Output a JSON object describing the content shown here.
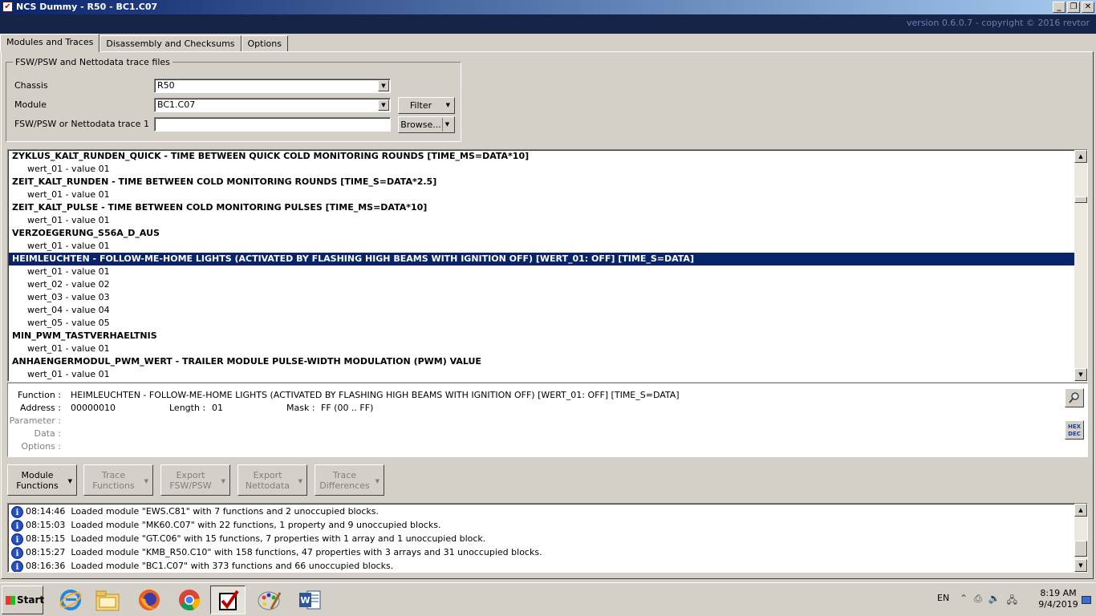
{
  "window": {
    "title": "NCS Dummy - R50 - BC1.C07",
    "minimize": "_",
    "restore": "❐",
    "close": "✕"
  },
  "banner": {
    "version": "version 0.6.0.7 - copyright © 2016 revtor"
  },
  "tabs": [
    {
      "label": "Modules and Traces"
    },
    {
      "label": "Disassembly and Checksums"
    },
    {
      "label": "Options"
    }
  ],
  "files": {
    "legend": "FSW/PSW and Nettodata trace files",
    "chassis_label": "Chassis",
    "chassis_value": "R50",
    "module_label": "Module",
    "module_value": "BC1.C07",
    "trace_label": "FSW/PSW or Nettodata trace 1",
    "trace_value": "",
    "filter_label": "Filter",
    "browse_label": "Browse..."
  },
  "functions": [
    {
      "type": "func",
      "text": "ZYKLUS_KALT_RUNDEN_QUICK  -  TIME BETWEEN QUICK COLD MONITORING ROUNDS [TIME_MS=DATA*10]"
    },
    {
      "type": "val",
      "text": "wert_01  -  value 01"
    },
    {
      "type": "func",
      "text": "ZEIT_KALT_RUNDEN  -  TIME BETWEEN COLD MONITORING ROUNDS [TIME_S=DATA*2.5]"
    },
    {
      "type": "val",
      "text": "wert_01  -  value 01"
    },
    {
      "type": "func",
      "text": "ZEIT_KALT_PULSE  -  TIME BETWEEN COLD MONITORING PULSES [TIME_MS=DATA*10]"
    },
    {
      "type": "val",
      "text": "wert_01  -  value 01"
    },
    {
      "type": "func",
      "text": "VERZOEGERUNG_S56A_D_AUS"
    },
    {
      "type": "val",
      "text": "wert_01  -  value 01"
    },
    {
      "type": "func",
      "selected": true,
      "text": "HEIMLEUCHTEN  -  FOLLOW-ME-HOME LIGHTS (ACTIVATED BY FLASHING HIGH BEAMS WITH IGNITION OFF) [WERT_01: OFF] [TIME_S=DATA]"
    },
    {
      "type": "val",
      "text": "wert_01  -  value 01"
    },
    {
      "type": "val",
      "text": "wert_02  -  value 02"
    },
    {
      "type": "val",
      "text": "wert_03  -  value 03"
    },
    {
      "type": "val",
      "text": "wert_04  -  value 04"
    },
    {
      "type": "val",
      "text": "wert_05  -  value 05"
    },
    {
      "type": "func",
      "text": "MIN_PWM_TASTVERHAELTNIS"
    },
    {
      "type": "val",
      "text": "wert_01  -  value 01"
    },
    {
      "type": "func",
      "text": "ANHAENGERMODUL_PWM_WERT  -  TRAILER MODULE PULSE-WIDTH MODULATION (PWM) VALUE"
    },
    {
      "type": "val",
      "text": "wert_01  -  value 01"
    }
  ],
  "detail": {
    "function_label": "Function :",
    "function_value": "HEIMLEUCHTEN  -  FOLLOW-ME-HOME LIGHTS (ACTIVATED BY FLASHING HIGH BEAMS WITH IGNITION OFF) [WERT_01: OFF] [TIME_S=DATA]",
    "address_label": "Address :",
    "address_value": "00000010",
    "length_label": "Length :",
    "length_value": "01",
    "mask_label": "Mask :",
    "mask_value": "FF  (00 .. FF)",
    "parameter_label": "Parameter :",
    "data_label": "Data :",
    "options_label": "Options :",
    "hexdec_top": "HEX",
    "hexdec_bottom": "DEC"
  },
  "actions": [
    {
      "line1": "Module",
      "line2": "Functions",
      "enabled": true
    },
    {
      "line1": "Trace",
      "line2": "Functions",
      "enabled": false
    },
    {
      "line1": "Export",
      "line2": "FSW/PSW",
      "enabled": false
    },
    {
      "line1": "Export",
      "line2": "Nettodata",
      "enabled": false
    },
    {
      "line1": "Trace",
      "line2": "Differences",
      "enabled": false
    }
  ],
  "log": [
    {
      "time": "08:14:46",
      "text": "Loaded module \"EWS.C81\" with 7 functions and 2 unoccupied blocks."
    },
    {
      "time": "08:15:03",
      "text": "Loaded module \"MK60.C07\" with 22 functions, 1 property and 9 unoccupied blocks."
    },
    {
      "time": "08:15:15",
      "text": "Loaded module \"GT.C06\" with 15 functions, 7 properties with 1 array and 1 unoccupied block."
    },
    {
      "time": "08:15:27",
      "text": "Loaded module \"KMB_R50.C10\" with 158 functions, 47 properties with 3 arrays and 31 unoccupied blocks."
    },
    {
      "time": "08:16:36",
      "text": "Loaded module \"BC1.C07\" with 373 functions and 66 unoccupied blocks."
    }
  ],
  "taskbar": {
    "start_label": "Start",
    "apps": [
      "internet-explorer-icon",
      "file-explorer-icon",
      "firefox-icon",
      "chrome-icon",
      "ncs-dummy-icon",
      "paint-icon",
      "word-icon"
    ],
    "language": "EN",
    "time": "8:19 AM",
    "date": "9/4/2019"
  }
}
